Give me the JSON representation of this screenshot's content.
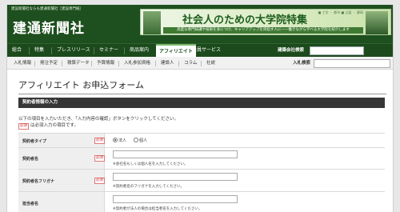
{
  "header": {
    "tagline": "建設新聞社ならも建通新聞社［建設専門紙］",
    "logo": "建通新聞社"
  },
  "banner": {
    "top_line": "■ 工学 ・ 都市 ■ 山梨 ・ 静岡",
    "main": "社会人のための大学院特集",
    "sub": "高度な専門知識や技術を身につけ、キャリアアップを目指す人に――働きながら学べる大学院を紹介します"
  },
  "nav_main": {
    "items": [
      "総合",
      "特集",
      "プレスリリース",
      "セミナー",
      "商品案内",
      "アフィリエイト",
      "会員サービス"
    ],
    "active_index": 5,
    "search_label": "建築会社検索",
    "search_value": ""
  },
  "nav_sub": {
    "items": [
      "入札情報",
      "発注予定",
      "積算データ",
      "予算情報",
      "入札参加資格",
      "建設人",
      "コラム",
      "社説"
    ],
    "search_label": "入札検索",
    "search_value": ""
  },
  "page": {
    "title": "アフィリエイト お申込フォーム",
    "section_title": "契約者情報の入力",
    "intro_line1": "以下の項目を入力いただき、「入力内容の確認」ボタンをクリックしてください。",
    "required_tag": "必須",
    "intro_line2": "は必須入力の項目です。"
  },
  "form": {
    "required_tag": "必須",
    "type_label": "契約者タイプ",
    "type_options": [
      "法人",
      "個人"
    ],
    "type_selected": 0,
    "name_label": "契約者名",
    "name_note": "※会社名もしくは個人名を入力してください。",
    "kana_label": "契約者名フリガナ",
    "kana_note": "※契約者名のフリガナを入力してください。",
    "person_label": "担当者名",
    "person_note": "※契約者が法人の場合は担当者名を入力してください。"
  },
  "colors": {
    "header_green": "#1e4f1e",
    "nav_green": "#1c4a1c",
    "section_bar": "#363636",
    "required_red": "#c33"
  }
}
